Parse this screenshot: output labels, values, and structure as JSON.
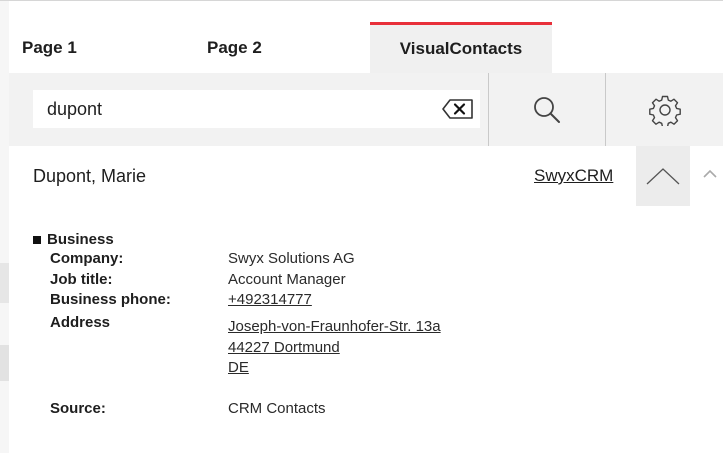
{
  "tabs": [
    {
      "label": "Page 1"
    },
    {
      "label": "Page 2"
    },
    {
      "label": "VisualContacts",
      "active": true
    }
  ],
  "search": {
    "value": "dupont",
    "clear_icon": "backspace-x-icon",
    "search_icon": "magnifier-icon",
    "settings_icon": "gear-icon"
  },
  "contact": {
    "name": "Dupont, Marie",
    "crm_link": "SwyxCRM",
    "section": "Business",
    "company_label": "Company:",
    "company_value": "Swyx Solutions AG",
    "jobtitle_label": "Job title:",
    "jobtitle_value": "Account Manager",
    "phone_label": "Business phone:",
    "phone_value": "+492314777",
    "address_label": "Address",
    "address_line1": "Joseph-von-Fraunhofer-Str. 13a",
    "address_line2": "44227 Dortmund",
    "address_line3": "DE",
    "source_label": "Source:",
    "source_value": "CRM Contacts"
  },
  "colors": {
    "active_tab_accent": "#e8303a",
    "search_row_bg": "#f2f2f2"
  }
}
